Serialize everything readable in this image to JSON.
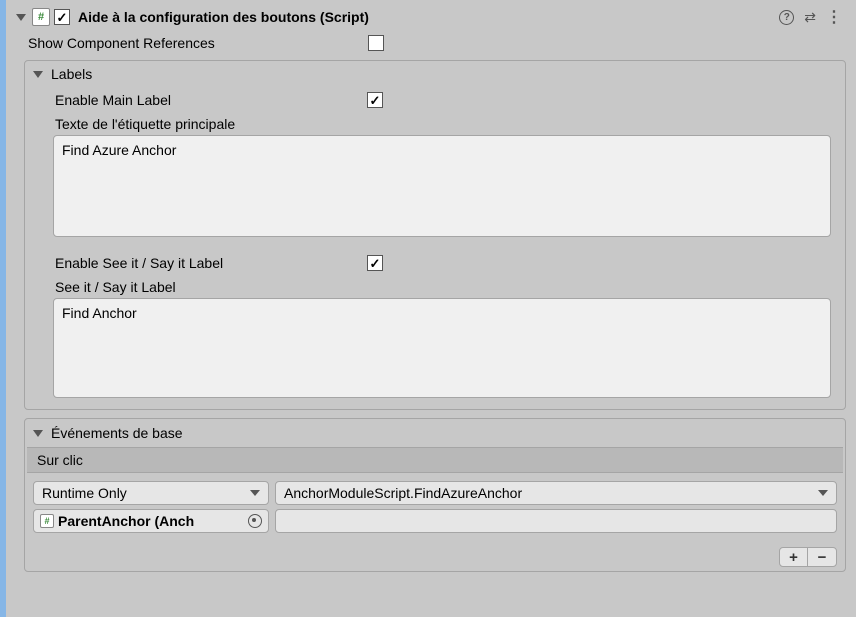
{
  "header": {
    "title": "Aide à la configuration des boutons (Script)",
    "enabled": true
  },
  "show_component_references": {
    "label": "Show Component References",
    "value": false
  },
  "labels_group": {
    "title": "Labels",
    "enable_main_label": {
      "label": "Enable Main Label",
      "value": true
    },
    "main_label_text": {
      "label": "Texte de l'étiquette principale",
      "value": "Find Azure Anchor"
    },
    "enable_seeit": {
      "label": "Enable See it / Say it Label",
      "value": true
    },
    "seeit_text": {
      "label": "See it / Say it Label",
      "value": "Find Anchor"
    }
  },
  "events_group": {
    "title": "Événements de base",
    "onclick_label": "Sur clic",
    "call_time": "Runtime Only",
    "method": "AnchorModuleScript.FindAzureAnchor",
    "target": "ParentAnchor (Anch",
    "argument": ""
  }
}
